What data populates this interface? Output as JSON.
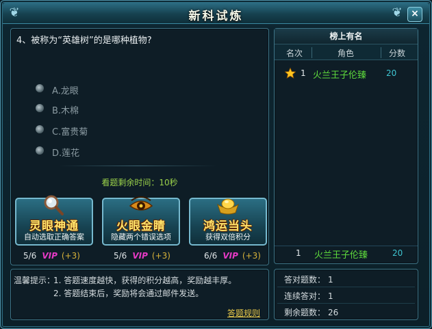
{
  "window": {
    "title": "新科试炼",
    "close_label": "×"
  },
  "question": {
    "text": "4、被称为“英雄树”的是哪种植物?",
    "options": [
      {
        "label": "A.龙眼"
      },
      {
        "label": "B.木棉"
      },
      {
        "label": "C.富贵菊"
      },
      {
        "label": "D.莲花"
      }
    ],
    "timer": "看题剩余时间：10秒"
  },
  "powerups": [
    {
      "name": "灵眼神通",
      "desc": "自动选取正确答案",
      "icon": "magnifier-icon",
      "count": "5/6",
      "vip": "VIP",
      "bonus": "(+3)"
    },
    {
      "name": "火眼金睛",
      "desc": "隐藏两个错误选项",
      "icon": "fiery-eye-icon",
      "count": "5/6",
      "vip": "VIP",
      "bonus": "(+3)"
    },
    {
      "name": "鸿运当头",
      "desc": "获得双倍积分",
      "icon": "gold-ingot-icon",
      "count": "6/6",
      "vip": "VIP",
      "bonus": "(+3)"
    }
  ],
  "tips": {
    "label": "温馨提示：",
    "items": [
      "1. 答题速度越快，获得的积分越高，奖励越丰厚。",
      "2. 答题结束后，奖励将会通过邮件发送。"
    ],
    "rules_link": "答题规则"
  },
  "leaderboard": {
    "title": "榜上有名",
    "columns": {
      "rank": "名次",
      "role": "角色",
      "score": "分数"
    },
    "rows": [
      {
        "rank": "1",
        "name": "火兰王子伦臻",
        "score": "20"
      }
    ],
    "me": {
      "rank": "1",
      "name": "火兰王子伦臻",
      "score": "20"
    }
  },
  "stats": [
    {
      "label": "答对题数：",
      "value": "1"
    },
    {
      "label": "连续答对：",
      "value": "1"
    },
    {
      "label": "剩余题数：",
      "value": "26"
    }
  ],
  "colors": {
    "accent_green": "#5fdc3c",
    "vip": "#e53ac5",
    "gold_text": "#ffe36a",
    "link": "#e8c94a"
  }
}
